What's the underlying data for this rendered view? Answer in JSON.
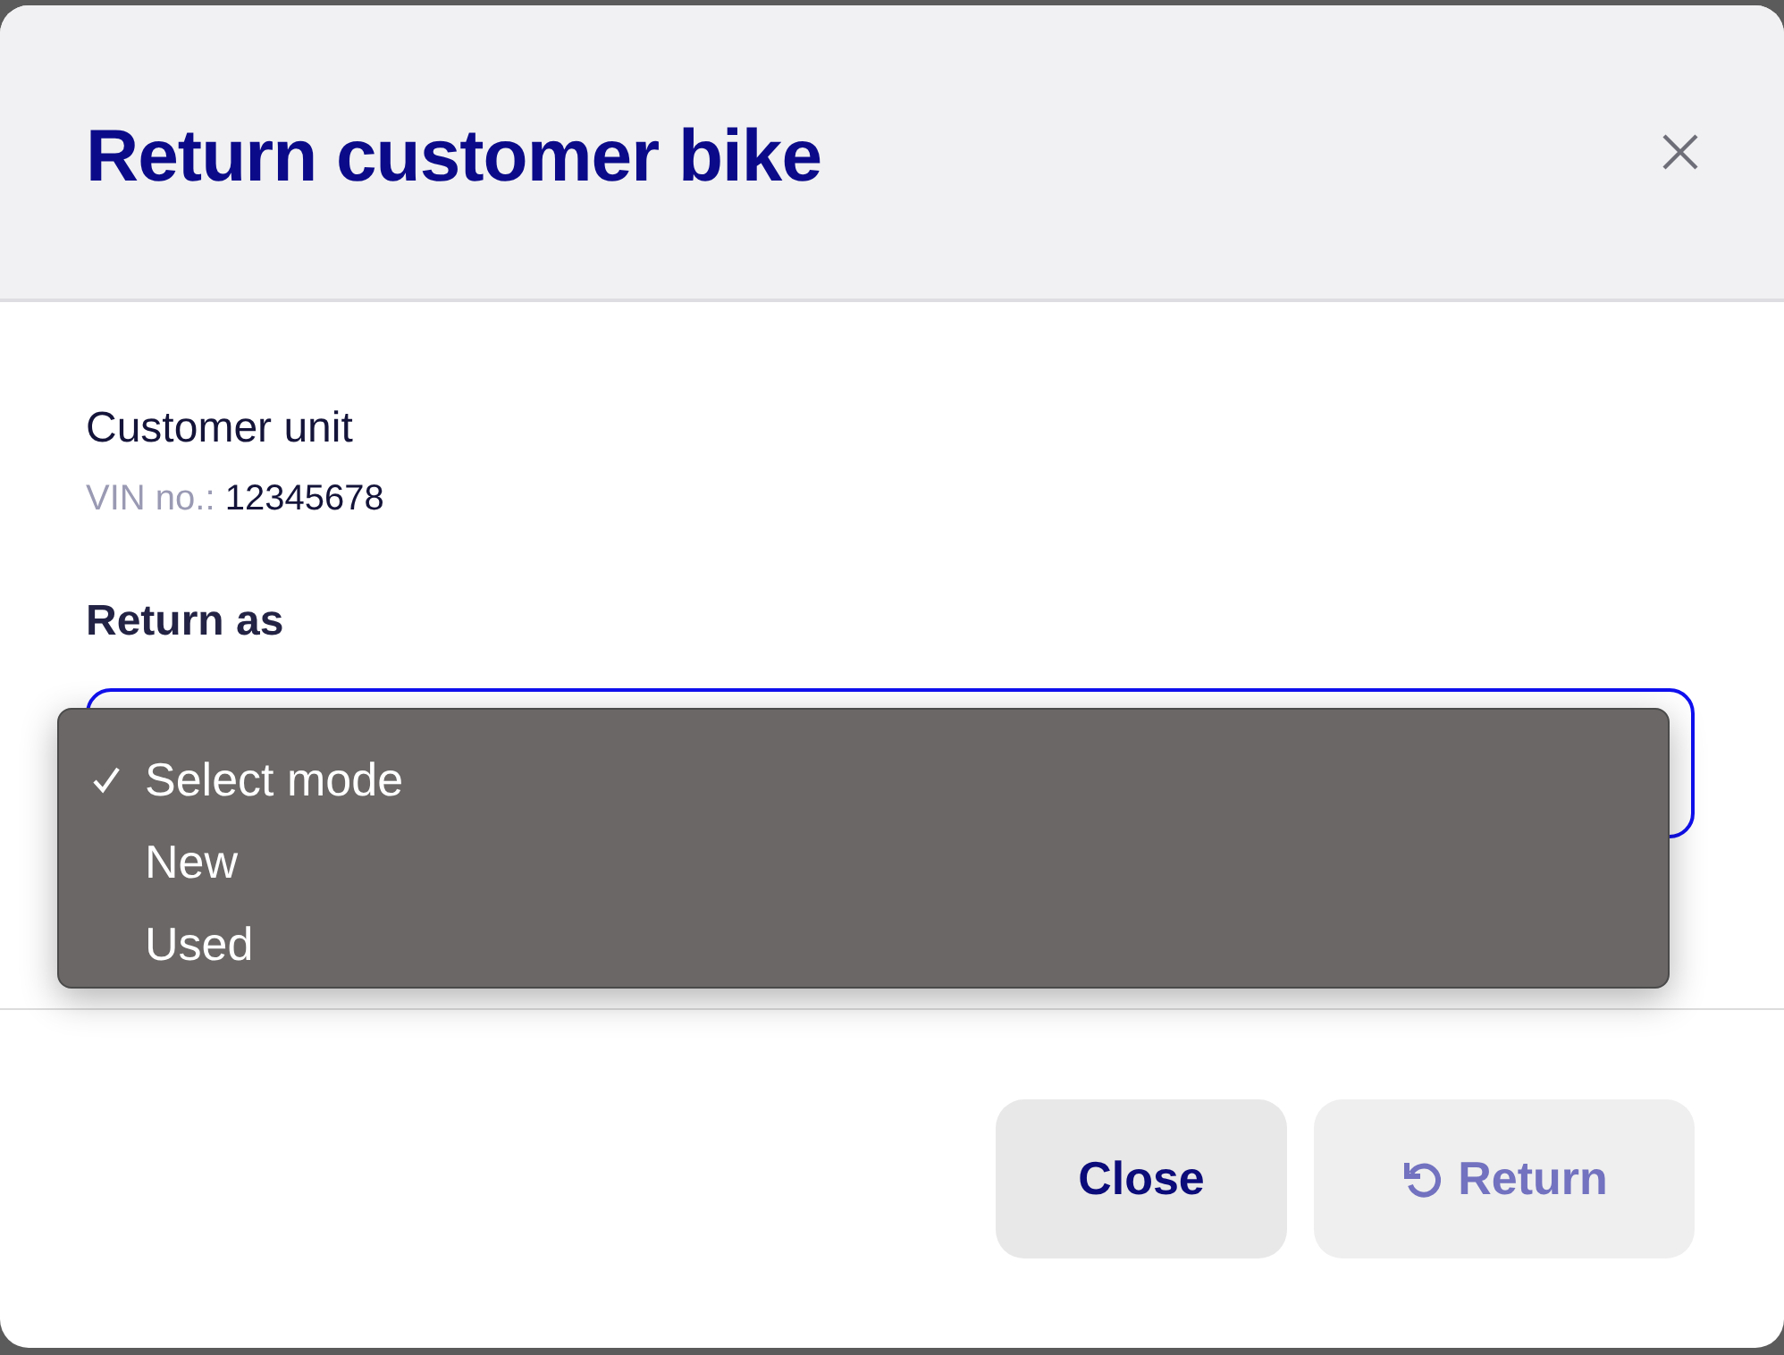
{
  "dialog": {
    "title": "Return customer bike",
    "unit": {
      "heading": "Customer unit",
      "vin_label": "VIN no.:",
      "vin_value": "12345678"
    },
    "return_as": {
      "label": "Return as",
      "expanded": true,
      "options": [
        {
          "label": "Select mode",
          "selected": true
        },
        {
          "label": "New",
          "selected": false
        },
        {
          "label": "Used",
          "selected": false
        }
      ]
    },
    "buttons": [
      {
        "label": "Close",
        "kind": "secondary",
        "disabled": false
      },
      {
        "label": "Return",
        "kind": "return",
        "disabled": true
      }
    ]
  }
}
